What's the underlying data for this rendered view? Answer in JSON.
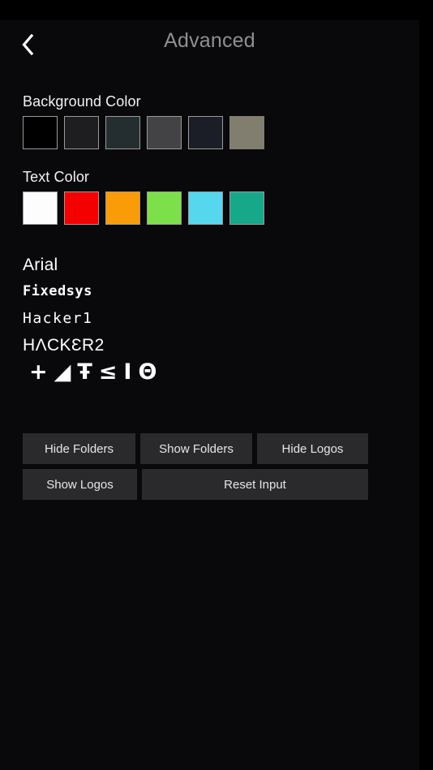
{
  "header": {
    "title": "Advanced",
    "back_icon": "chevron-left-icon"
  },
  "sections": {
    "background": {
      "label": "Background Color",
      "swatches": [
        {
          "name": "swatch-black",
          "color": "#000000",
          "bordered": true
        },
        {
          "name": "swatch-dark-gray",
          "color": "#1e1d1f",
          "bordered": true
        },
        {
          "name": "swatch-slate",
          "color": "#242d30",
          "bordered": true
        },
        {
          "name": "swatch-gray",
          "color": "#434245",
          "bordered": true
        },
        {
          "name": "swatch-navy",
          "color": "#1b1e26",
          "bordered": true
        },
        {
          "name": "swatch-tan",
          "color": "#817e6f",
          "bordered": false
        }
      ]
    },
    "text": {
      "label": "Text Color",
      "swatches": [
        {
          "name": "swatch-white",
          "color": "#fdfdfd",
          "bordered": true
        },
        {
          "name": "swatch-red",
          "color": "#f40000",
          "bordered": true
        },
        {
          "name": "swatch-orange",
          "color": "#fa9b08",
          "bordered": true
        },
        {
          "name": "swatch-green",
          "color": "#7ce04a",
          "bordered": true
        },
        {
          "name": "swatch-cyan",
          "color": "#55d7ee",
          "bordered": true
        },
        {
          "name": "swatch-teal",
          "color": "#16a888",
          "bordered": true
        }
      ]
    }
  },
  "fonts": [
    {
      "name": "font-arial",
      "label": "Arial"
    },
    {
      "name": "font-fixedsys",
      "label": "Fixedsys"
    },
    {
      "name": "font-hacker1",
      "label": "Hacker1"
    },
    {
      "name": "font-hacker2",
      "label": "HΛCKƐR2"
    },
    {
      "name": "font-symbol",
      "label": "+◢Ŧ≤ⅠΘ"
    }
  ],
  "buttons": {
    "hide_folders": "Hide Folders",
    "show_folders": "Show Folders",
    "hide_logos": "Hide Logos",
    "show_logos": "Show Logos",
    "reset_input": "Reset Input"
  }
}
